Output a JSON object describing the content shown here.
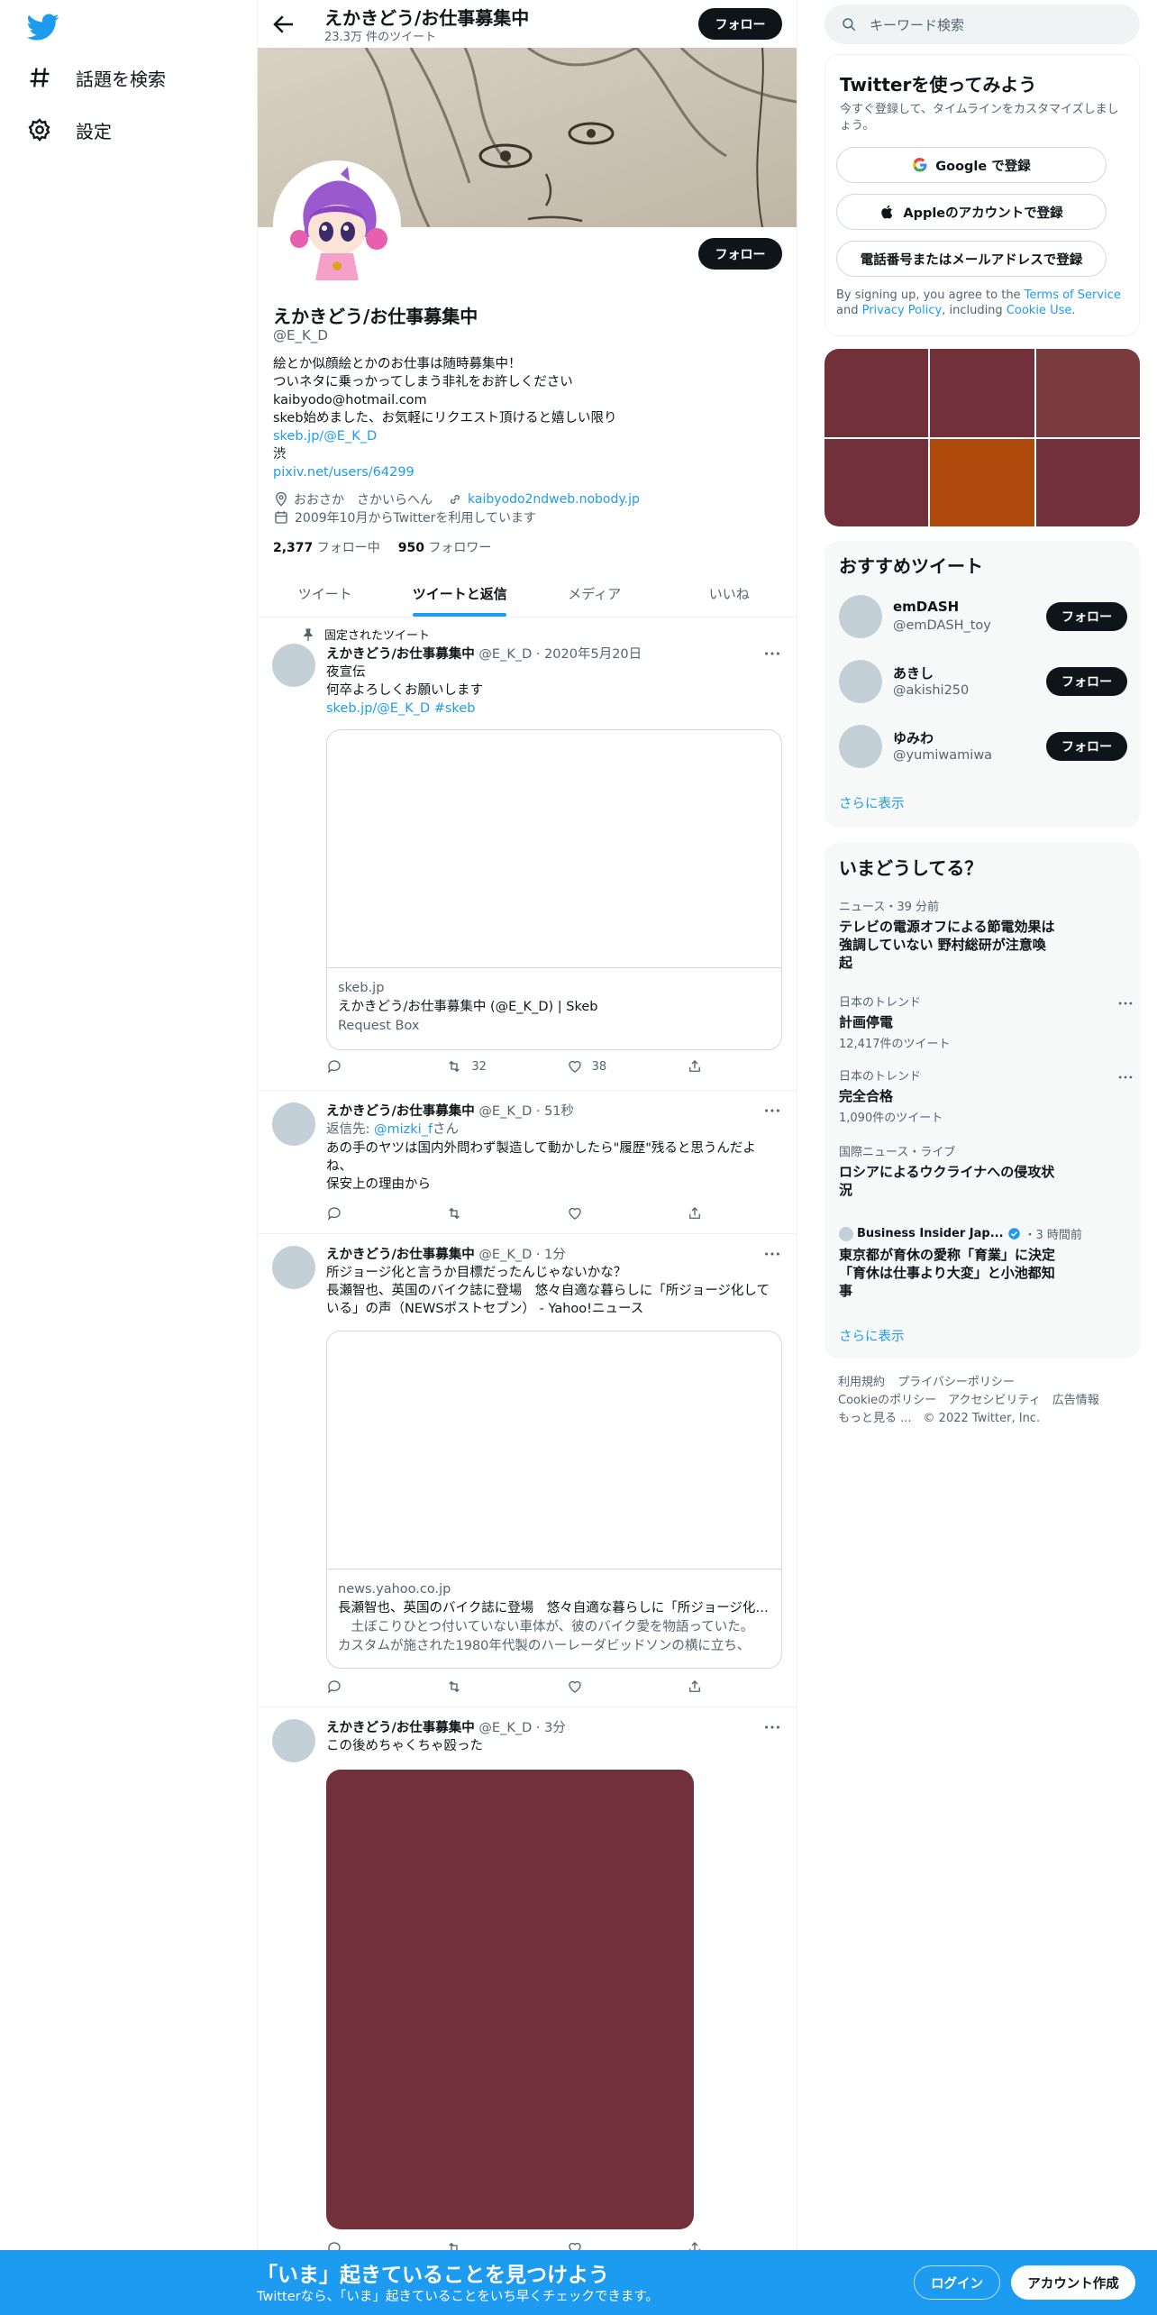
{
  "nav": {
    "explore_label": "話題を検索",
    "settings_label": "設定"
  },
  "header": {
    "title": "えかきどう/お仕事募集中",
    "tweet_count": "23.3万 件のツイート",
    "follow_label": "フォロー"
  },
  "profile": {
    "name": "えかきどう/お仕事募集中",
    "handle": "@E_K_D",
    "follow_label": "フォロー",
    "bio_lines": [
      "絵とか似顔絵とかのお仕事は随時募集中！",
      "ついネタに乗っかってしまう非礼をお許しください",
      "kaibyodo@hotmail.com",
      "skeb始めました、お気軽にリクエスト頂けると嬉しい限り"
    ],
    "bio_link1": "skeb.jp/@E_K_D",
    "bio_line5": "渋",
    "bio_link2": "pixiv.net/users/64299",
    "location": "おおさか　さかいらへん",
    "website": "kaibyodo2ndweb.nobody.jp",
    "joined": "2009年10月からTwitterを利用しています",
    "following_count": "2,377",
    "following_label": "フォロー中",
    "followers_count": "950",
    "followers_label": "フォロワー"
  },
  "tabs": [
    "ツイート",
    "ツイートと返信",
    "メディア",
    "いいね"
  ],
  "tweets": [
    {
      "pinned_label": "固定されたツイート",
      "name": "えかきどう/お仕事募集中",
      "meta": "@E_K_D · 2020年5月20日",
      "lines": [
        "夜宣伝",
        "何卒よろしくお願いします"
      ],
      "link": "skeb.jp/@E_K_D #skeb",
      "card_domain": "skeb.jp",
      "card_title": "えかきどう/お仕事募集中 (@E_K_D) | Skeb",
      "card_desc": "Request Box",
      "retweets": "32",
      "likes": "38"
    },
    {
      "name": "えかきどう/お仕事募集中",
      "meta": "@E_K_D · 51秒",
      "reply_prefix": "返信先: ",
      "reply_to": "@mizki_f",
      "reply_suffix": "さん",
      "lines": [
        "あの手のヤツは国内外問わず製造して動かしたら\"履歴\"残ると思うんだよ",
        "ね、",
        "保安上の理由から"
      ]
    },
    {
      "name": "えかきどう/お仕事募集中",
      "meta": "@E_K_D · 1分",
      "lines": [
        "所ジョージ化と言うか目標だったんじゃないかな？",
        "長瀬智也、英国のバイク誌に登場　悠々自適な暮らしに「所ジョージ化して",
        "いる」の声（NEWSポストセブン） - Yahoo!ニュース"
      ],
      "card_domain": "news.yahoo.co.jp",
      "card_title": "長瀬智也、英国のバイク誌に登場　悠々自適な暮らしに「所ジョージ化している」の声",
      "card_desc1": "　土ぼこりひとつ付いていない車体が、彼のバイク愛を物語っていた。",
      "card_desc2": "カスタムが施された1980年代製のハーレーダビッドソンの横に立ち、"
    },
    {
      "name": "えかきどう/お仕事募集中",
      "meta": "@E_K_D · 3分",
      "lines": [
        "この後めちゃくちゃ殴った"
      ]
    }
  ],
  "right": {
    "search_placeholder": "キーワード検索",
    "signup": {
      "title": "Twitterを使ってみよう",
      "subtitle": "今すぐ登録して、タイムラインをカスタマイズしましょう。",
      "google": "Google で登録",
      "apple": "Appleのアカウントで登録",
      "phone": "電話番号またはメールアドレスで登録",
      "legal_1": "By signing up, you agree to the ",
      "tos": "Terms of Service",
      "legal_2": " and ",
      "privacy": "Privacy Policy",
      "legal_3": ", including ",
      "cookie": "Cookie Use",
      "legal_4": "."
    },
    "recommend": {
      "title": "おすすめツイート",
      "users": [
        {
          "name": "emDASH",
          "handle": "@emDASH_toy",
          "follow": "フォロー"
        },
        {
          "name": "あきし",
          "handle": "@akishi250",
          "follow": "フォロー"
        },
        {
          "name": "ゆみわ",
          "handle": "@yumiwamiwa",
          "follow": "フォロー"
        }
      ],
      "more": "さらに表示"
    },
    "trends": {
      "title": "いまどうしてる？",
      "items": [
        {
          "context": "ニュース・39 分前",
          "title": "テレビの電源オフによる節電効果は強調していない 野村総研が注意喚起"
        },
        {
          "context": "日本のトレンド",
          "title": "計画停電",
          "count": "12,417件のツイート"
        },
        {
          "context": "日本のトレンド",
          "title": "完全合格",
          "count": "1,090件のツイート"
        },
        {
          "context": "国際ニュース・ライブ",
          "title": "ロシアによるウクライナへの侵攻状況"
        },
        {
          "source": "Business Insider Jap...",
          "time": "・3 時間前",
          "title": "東京都が育休の愛称「育業」に決定 「育休は仕事より大変」と小池都知事"
        }
      ],
      "more": "さらに表示"
    },
    "footer": {
      "terms": "利用規約",
      "privacy": "プライバシーポリシー",
      "cookie": "Cookieのポリシー",
      "accessibility": "アクセシビリティ",
      "ads": "広告情報",
      "more": "もっと見る ...",
      "copyright": "© 2022 Twitter, Inc."
    }
  },
  "bottom": {
    "headline": "「いま」起きていることを見つけよう",
    "sub": "Twitterなら、「いま」起きていることをいち早くチェックできます。",
    "login": "ログイン",
    "signup": "アカウント作成"
  },
  "colors": {
    "accent": "#1d9bf0",
    "dark_button": "#0f1419",
    "media_tile": "#72313a",
    "media_tile_orange": "#b04a0c"
  }
}
